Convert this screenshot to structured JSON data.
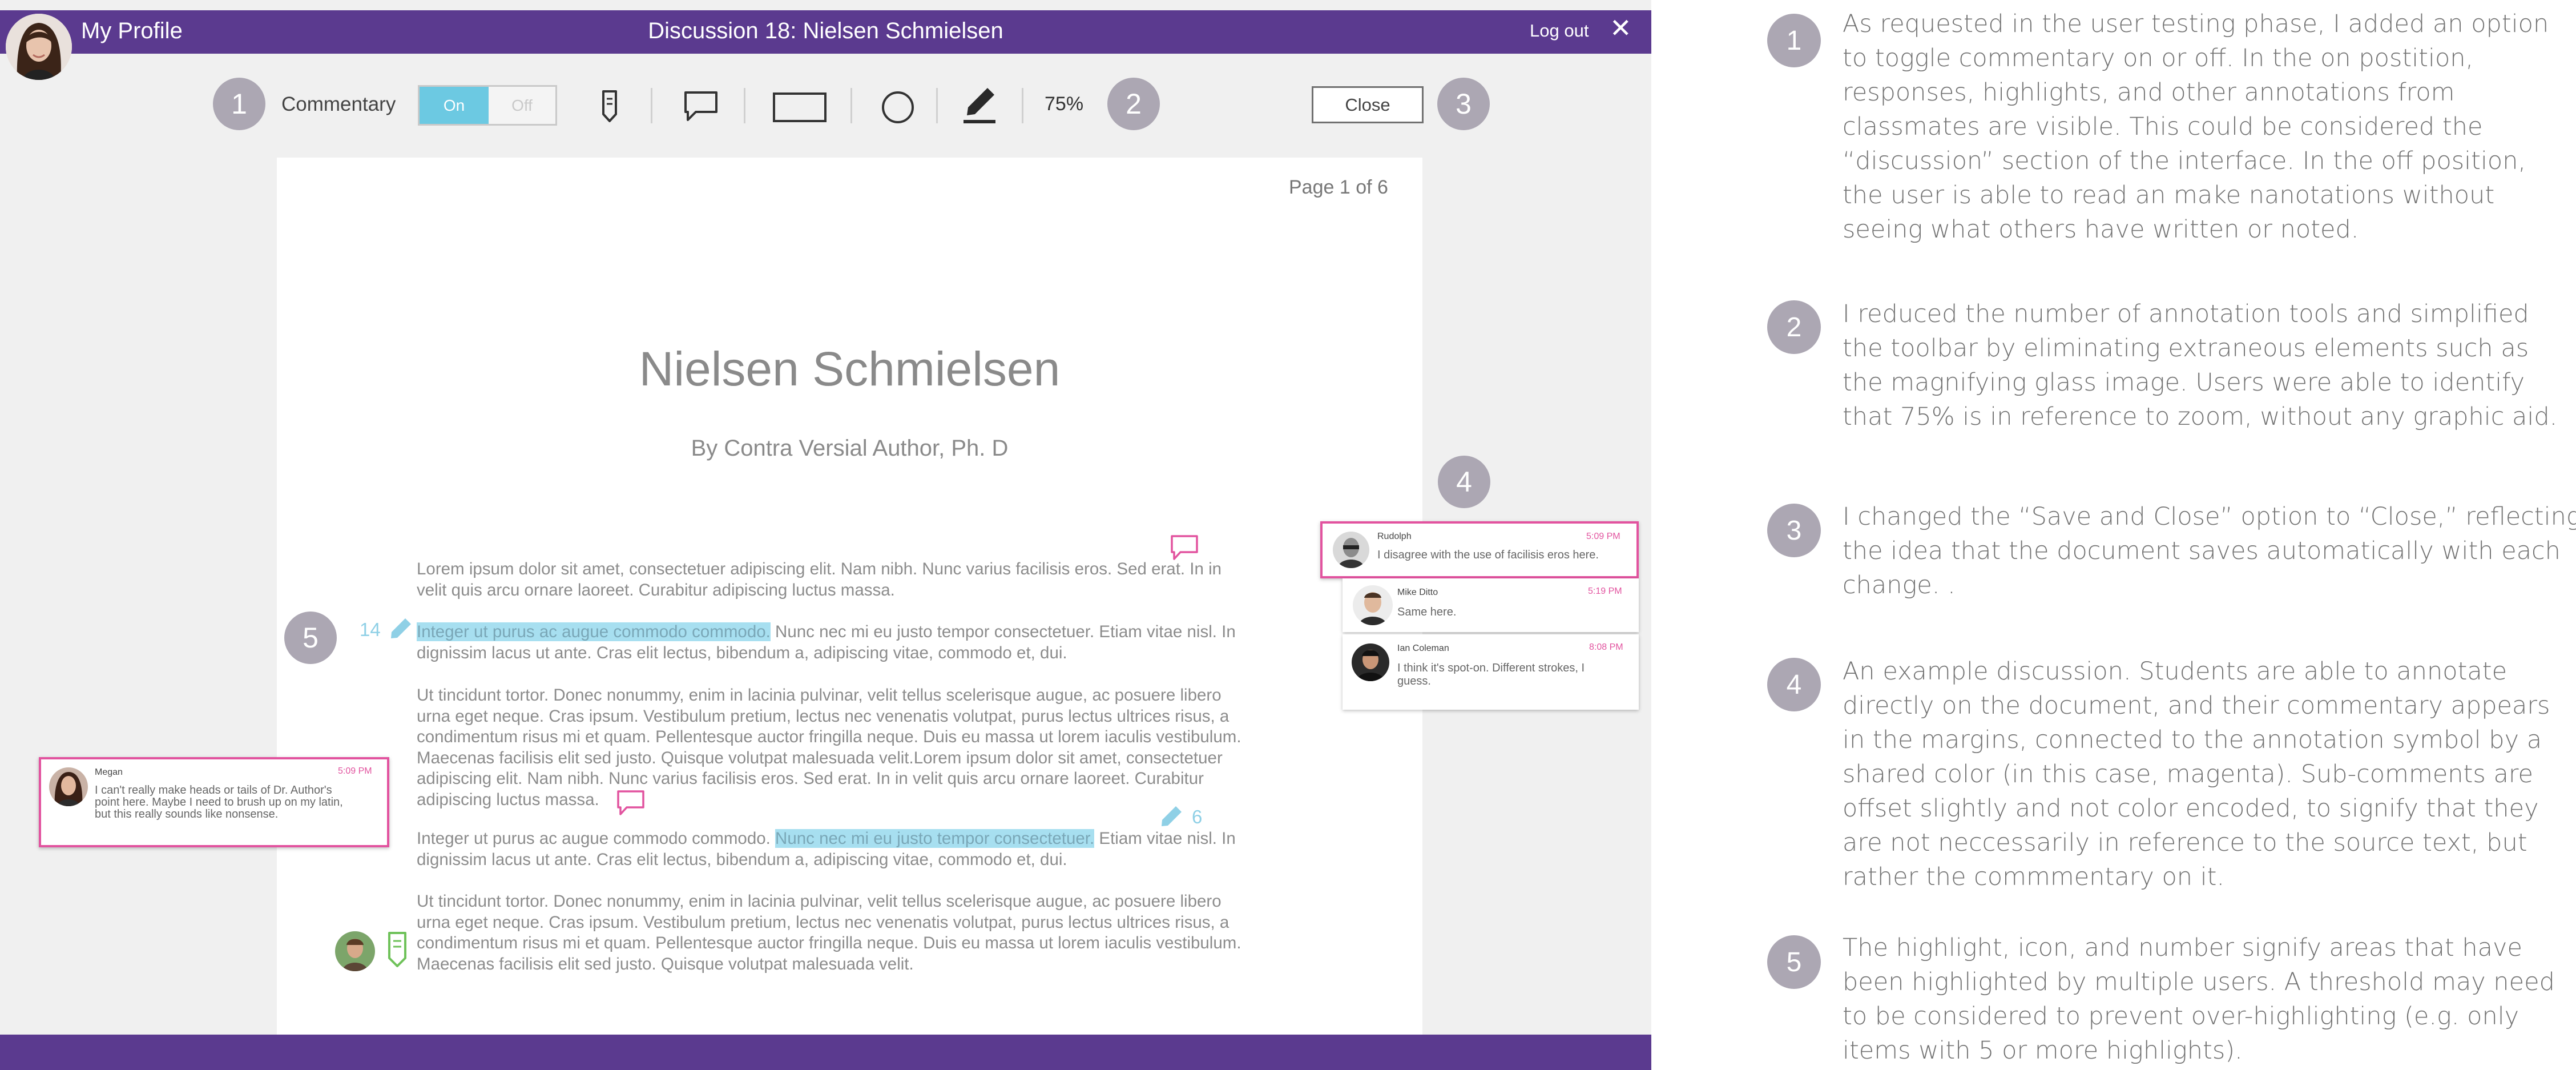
{
  "header": {
    "profile_label": "My Profile",
    "title": "Discussion 18: Nielsen Schmielsen",
    "logout_label": "Log out",
    "close_symbol": "✕"
  },
  "toolbar": {
    "commentary_label": "Commentary",
    "toggle_on": "On",
    "toggle_off": "Off",
    "zoom": "75%",
    "close_label": "Close",
    "tools": [
      "bookmark-icon",
      "comment-bubble-icon",
      "rectangle-icon",
      "circle-icon",
      "highlighter-icon"
    ]
  },
  "steps": [
    "1",
    "2",
    "3",
    "4",
    "5"
  ],
  "document": {
    "page_indicator": "Page 1 of 6",
    "title": "Nielsen Schmielsen",
    "author": "By Contra Versial Author, Ph. D",
    "p1": [
      "Lorem ipsum dolor sit amet, consectetuer adipiscing elit. Nam nibh. Nunc varius facilisis eros. Sed erat. In in",
      "velit quis arcu ornare laoreet. Curabitur adipiscing luctus massa."
    ],
    "p2_highlight": "Integer ut purus ac augue commodo commodo.",
    "p2_rest": " Nunc nec mi eu justo tempor consectetuer. Etiam vitae nisl. In",
    "p2_line2": "dignissim lacus ut ante. Cras elit lectus, bibendum a, adipiscing vitae, commodo et, dui.",
    "p3": [
      "Ut tincidunt tortor. Donec nonummy, enim in lacinia pulvinar, velit tellus scelerisque augue, ac posuere libero",
      "urna eget neque. Cras ipsum. Vestibulum pretium, lectus nec venenatis volutpat, purus lectus ultrices risus, a",
      "condimentum risus mi et quam. Pellentesque auctor fringilla neque. Duis eu massa ut lorem iaculis vestibulum.",
      "Maecenas facilisis elit sed justo. Quisque volutpat malesuada velit.Lorem ipsum dolor sit amet, consectetuer",
      "adipiscing elit. Nam nibh. Nunc varius facilisis eros. Sed erat. In in velit quis arcu ornare laoreet. Curabitur",
      "adipiscing luctus massa."
    ],
    "p4_start": "Integer ut purus ac augue commodo commodo. ",
    "p4_highlight": "Nunc nec mi eu justo tempor consectetuer.",
    "p4_rest": " Etiam vitae nisl. In",
    "p4_line2": "dignissim lacus ut ante. Cras elit lectus, bibendum a, adipiscing vitae, commodo et, dui.",
    "p5": [
      "Ut tincidunt tortor. Donec nonummy, enim in lacinia pulvinar, velit tellus scelerisque augue, ac posuere libero",
      "urna eget neque. Cras ipsum. Vestibulum pretium, lectus nec venenatis volutpat, purus lectus ultrices risus, a",
      "condimentum risus mi et quam. Pellentesque auctor fringilla neque. Duis eu massa ut lorem iaculis vestibulum.",
      "Maecenas facilisis elit sed justo. Quisque volutpat malesuada velit."
    ],
    "highlight_count_1": "14",
    "highlight_count_2": "6"
  },
  "comments": {
    "rudolph": {
      "name": "Rudolph",
      "time": "5:09 PM",
      "text": "I disagree with the use of facilisis eros here."
    },
    "mike": {
      "name": "Mike Ditto",
      "time": "5:19 PM",
      "text": "Same here."
    },
    "ian": {
      "name": "Ian Coleman",
      "time": "8:08 PM",
      "text": [
        "I think it's spot-on. Different strokes, I",
        "guess."
      ]
    },
    "megan": {
      "name": "Megan",
      "time": "5:09 PM",
      "text": [
        "I can't really make heads or tails of Dr. Author's",
        "point here. Maybe I need to brush up on my latin,",
        "but this really sounds like nonsense."
      ]
    }
  },
  "notes": [
    {
      "num": "1",
      "lines": [
        "As requested in the user testing phase, I added an option",
        "to toggle commentary on or off. In the on postition,",
        "responses, highlights, and other annotations from",
        "classmates are visible. This could be considered the",
        "“discussion” section of the interface. In the off position,",
        "the user is able to read an make nanotations without",
        "seeing what others have written or noted."
      ]
    },
    {
      "num": "2",
      "lines": [
        "I reduced the number of annotation tools and simplified",
        "the toolbar by eliminating extraneous elements such as",
        "the magnifying glass image. Users were able to identify",
        "that 75% is in reference to zoom, without any graphic aid."
      ]
    },
    {
      "num": "3",
      "lines": [
        "I changed the “Save and Close” option to “Close,” reflecting",
        "the idea that the document saves automatically with each",
        "change. ."
      ]
    },
    {
      "num": "4",
      "lines": [
        "An example discussion. Students are able to annotate",
        "directly on the document, and their commentary appears",
        "in the margins, connected to the annotation symbol by a",
        "shared color (in this case, magenta). Sub-comments are",
        "offset slightly and not color encoded, to signify that they",
        "are not neccessarily in reference to the source text, but",
        "rather the commmentary on it."
      ]
    },
    {
      "num": "5",
      "lines": [
        "The highlight, icon, and number signify areas that have",
        "been highlighted by multiple users. A threshold may need",
        "to be considered to prevent over-highlighting (e.g. only",
        "items with 5 or more highlights)."
      ]
    }
  ],
  "colors": {
    "purple": "#5b3a8f",
    "magenta": "#e2539f",
    "cyan": "#6cc9e2",
    "green": "#6fc25a",
    "step_gray": "#aca7b3"
  }
}
